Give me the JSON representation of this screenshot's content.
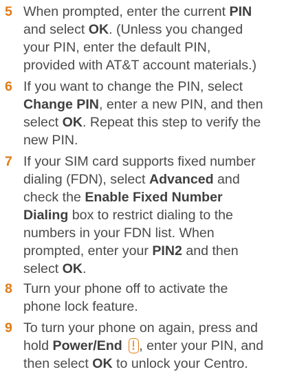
{
  "steps": [
    {
      "number": "5",
      "lines": [
        [
          {
            "t": "When prompted, enter the current "
          },
          {
            "t": "PIN",
            "b": true
          }
        ],
        [
          {
            "t": "and select "
          },
          {
            "t": "OK",
            "b": true
          },
          {
            "t": ". (Unless you changed"
          }
        ],
        [
          {
            "t": "your  PIN, enter the default PIN,"
          }
        ],
        [
          {
            "t": "provided with AT&T account  materials.)"
          }
        ]
      ]
    },
    {
      "number": "6",
      "lines": [
        [
          {
            "t": "If you want to change the PIN, select"
          }
        ],
        [
          {
            "t": "Change PIN",
            "b": true
          },
          {
            "t": ", enter a new PIN, and then"
          }
        ],
        [
          {
            "t": "select "
          },
          {
            "t": "OK",
            "b": true
          },
          {
            "t": ". Repeat this step to verify the"
          }
        ],
        [
          {
            "t": "new PIN."
          }
        ]
      ]
    },
    {
      "number": "7",
      "lines": [
        [
          {
            "t": "If your SIM card supports fixed number"
          }
        ],
        [
          {
            "t": "dialing (FDN), select "
          },
          {
            "t": "Advanced",
            "b": true
          },
          {
            "t": " and"
          }
        ],
        [
          {
            "t": "check the "
          },
          {
            "t": "Enable Fixed Number",
            "b": true
          }
        ],
        [
          {
            "t": "Dialing",
            "b": true
          },
          {
            "t": " box to restrict dialing to the"
          }
        ],
        [
          {
            "t": "numbers in your FDN list. When"
          }
        ],
        [
          {
            "t": "prompted, enter your "
          },
          {
            "t": "PIN2",
            "b": true
          },
          {
            "t": " and then"
          }
        ],
        [
          {
            "t": "select "
          },
          {
            "t": "OK",
            "b": true
          },
          {
            "t": "."
          }
        ]
      ]
    },
    {
      "number": "8",
      "lines": [
        [
          {
            "t": "Turn your phone off to activate the"
          }
        ],
        [
          {
            "t": "phone lock feature."
          }
        ]
      ]
    },
    {
      "number": "9",
      "lines": [
        [
          {
            "t": "To turn your phone on again, press and"
          }
        ],
        [
          {
            "t": "hold "
          },
          {
            "t": "Power/End",
            "b": true
          },
          {
            "t": " "
          },
          {
            "icon": "power-end-key-icon"
          },
          {
            "t": ", enter your PIN, and"
          }
        ],
        [
          {
            "t": "then select "
          },
          {
            "t": "OK",
            "b": true
          },
          {
            "t": " to unlock your Centro."
          }
        ]
      ]
    }
  ],
  "colors": {
    "step_number": "#e07b16",
    "text": "#4a4a4a",
    "icon": "#e07b16"
  }
}
